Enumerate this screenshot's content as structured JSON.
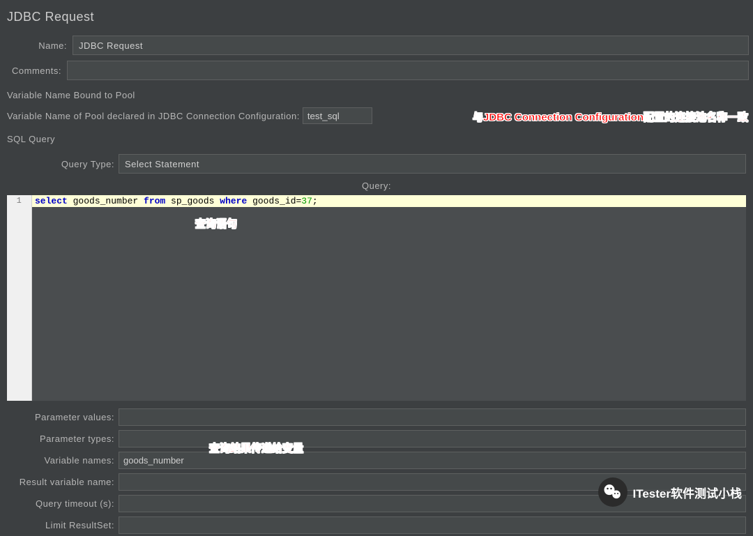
{
  "header": {
    "title": "JDBC Request"
  },
  "form": {
    "name_label": "Name:",
    "name_value": "JDBC Request",
    "comments_label": "Comments:",
    "comments_value": ""
  },
  "varpool": {
    "section_title": "Variable Name Bound to Pool",
    "label": "Variable Name of Pool declared in JDBC Connection Configuration:",
    "value": "test_sql"
  },
  "sql": {
    "section_title": "SQL Query",
    "query_type_label": "Query Type:",
    "query_type_value": "Select Statement",
    "query_header": "Query:",
    "line_number": "1",
    "code": {
      "kw1": "select",
      "t1": " goods_number ",
      "kw2": "from",
      "t2": " sp_goods ",
      "kw3": "where",
      "t3": " goods_id=",
      "num": "37",
      "t4": ";"
    }
  },
  "lower": {
    "param_values_label": "Parameter values:",
    "param_values": "",
    "param_types_label": "Parameter types:",
    "param_types": "",
    "var_names_label": "Variable names:",
    "var_names": "goods_number",
    "result_var_label": "Result variable name:",
    "result_var": "",
    "query_timeout_label": "Query timeout (s):",
    "query_timeout": "",
    "limit_rs_label": "Limit ResultSet:",
    "limit_rs": ""
  },
  "annotations": {
    "a1": "与JDBC Connection Configuration配置的连接池名称一致",
    "a2": "查询语句",
    "a3": "查询结果传递给变量"
  },
  "watermark": {
    "text": "ITester软件测试小栈"
  }
}
